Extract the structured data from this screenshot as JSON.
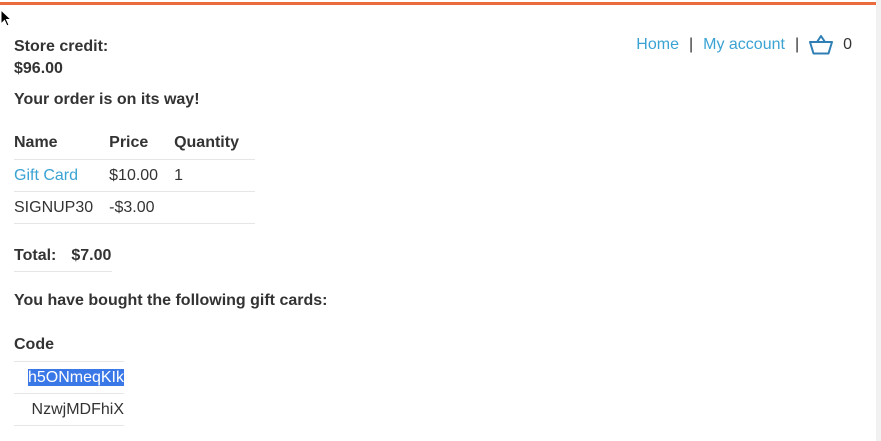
{
  "store_credit": {
    "label": "Store credit:",
    "amount": "$96.00"
  },
  "nav": {
    "home": "Home",
    "separator": "|",
    "my_account": "My account",
    "cart_count": "0"
  },
  "order_message": "Your order is on its way!",
  "items_table": {
    "headers": [
      "Name",
      "Price",
      "Quantity"
    ],
    "rows": [
      {
        "name": "Gift Card",
        "price": "$10.00",
        "quantity": "1"
      },
      {
        "name": "SIGNUP30",
        "price": "-$3.00",
        "quantity": ""
      }
    ]
  },
  "total": {
    "label": "Total:",
    "value": "$7.00"
  },
  "gift_cards": {
    "heading": "You have bought the following gift cards:",
    "column_header": "Code",
    "codes": [
      "h5ONmeqKIk",
      "NzwjMDFhiX"
    ]
  },
  "colors": {
    "accent": "#ec6b3c",
    "link": "#3aa3d3",
    "selection": "#3b78e7"
  }
}
